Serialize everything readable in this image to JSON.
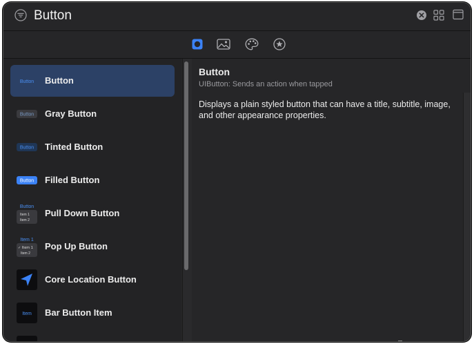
{
  "search": {
    "value": "Button"
  },
  "tabs": [
    {
      "name": "objects",
      "icon": "square-circle-icon",
      "active": true
    },
    {
      "name": "media",
      "icon": "photo-icon",
      "active": false
    },
    {
      "name": "colors",
      "icon": "palette-icon",
      "active": false
    },
    {
      "name": "modifiers",
      "icon": "star-circle-icon",
      "active": false
    }
  ],
  "library_items": [
    {
      "label": "Button",
      "thumb_text": "Button",
      "selected": true
    },
    {
      "label": "Gray Button",
      "thumb_text": "Button"
    },
    {
      "label": "Tinted Button",
      "thumb_text": "Button"
    },
    {
      "label": "Filled Button",
      "thumb_text": "Button"
    },
    {
      "label": "Pull Down Button",
      "thumb_text": "Button",
      "thumb_items": [
        "Item 1",
        "Item 2"
      ]
    },
    {
      "label": "Pop Up Button",
      "thumb_text": "Item 1",
      "thumb_items": [
        "✓ Item 1",
        "Item 2"
      ]
    },
    {
      "label": "Core Location Button",
      "thumb_icon": "location-arrow-icon"
    },
    {
      "label": "Bar Button Item",
      "thumb_text": "Item"
    }
  ],
  "detail": {
    "title": "Button",
    "subtitle": "UIButton: Sends an action when tapped",
    "description": "Displays a plain styled button that can have a title, subtitle, image, and other appearance properties."
  },
  "colors": {
    "accent": "#3b82f6",
    "selected_row": "#2c4166",
    "background": "#262628"
  }
}
